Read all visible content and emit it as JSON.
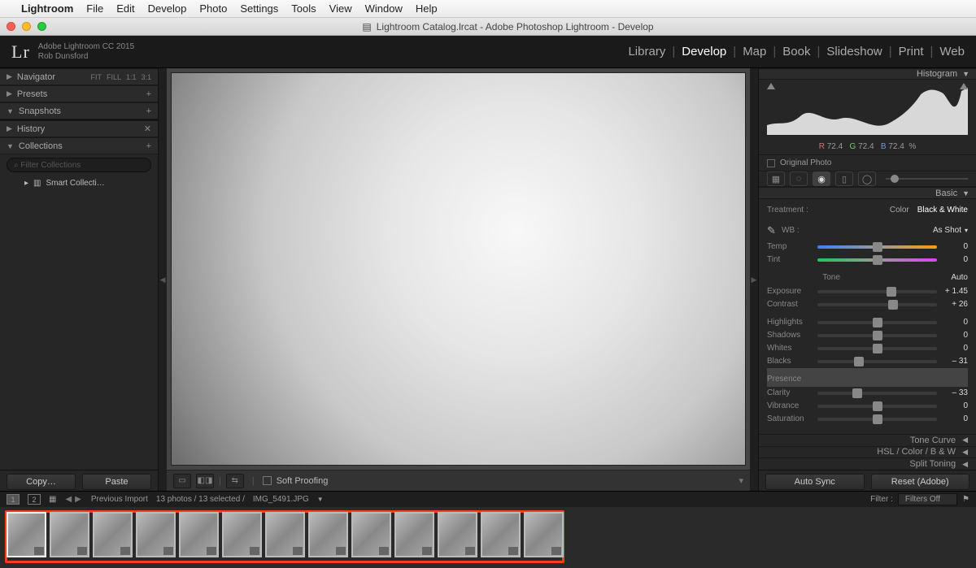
{
  "mac_menu": {
    "apple": "",
    "app": "Lightroom",
    "items": [
      "File",
      "Edit",
      "Develop",
      "Photo",
      "Settings",
      "Tools",
      "View",
      "Window",
      "Help"
    ]
  },
  "window_title": "Lightroom Catalog.lrcat - Adobe Photoshop Lightroom - Develop",
  "identity": {
    "product": "Adobe Lightroom CC 2015",
    "user": "Rob Dunsford",
    "logo": "Lr"
  },
  "modules": {
    "items": [
      "Library",
      "Develop",
      "Map",
      "Book",
      "Slideshow",
      "Print",
      "Web"
    ],
    "active": "Develop"
  },
  "left_panels": {
    "navigator": {
      "label": "Navigator",
      "opts": [
        "FIT",
        "FILL",
        "1:1",
        "3:1"
      ]
    },
    "presets": {
      "label": "Presets"
    },
    "snapshots": {
      "label": "Snapshots"
    },
    "history": {
      "label": "History"
    },
    "collections": {
      "label": "Collections",
      "search_placeholder": "Filter Collections",
      "item": "Smart Collecti…"
    }
  },
  "left_buttons": {
    "copy": "Copy…",
    "paste": "Paste"
  },
  "soft_proof": {
    "label": "Soft Proofing",
    "checked": false
  },
  "histogram": {
    "label": "Histogram",
    "readout": {
      "r": "72.4",
      "g": "72.4",
      "b": "72.4",
      "pct": "%"
    },
    "original_photo": "Original Photo"
  },
  "basic": {
    "label": "Basic",
    "treatment": {
      "label": "Treatment :",
      "color": "Color",
      "bw": "Black & White",
      "active": "bw"
    },
    "wb": {
      "label": "WB :",
      "preset": "As Shot",
      "temp": {
        "label": "Temp",
        "value": "0",
        "pos": 50
      },
      "tint": {
        "label": "Tint",
        "value": "0",
        "pos": 50
      }
    },
    "tone": {
      "label": "Tone",
      "auto": "Auto",
      "exposure": {
        "label": "Exposure",
        "value": "+ 1.45",
        "pos": 62
      },
      "contrast": {
        "label": "Contrast",
        "value": "+ 26",
        "pos": 63
      },
      "highlights": {
        "label": "Highlights",
        "value": "0",
        "pos": 50
      },
      "shadows": {
        "label": "Shadows",
        "value": "0",
        "pos": 50
      },
      "whites": {
        "label": "Whites",
        "value": "0",
        "pos": 50
      },
      "blacks": {
        "label": "Blacks",
        "value": "– 31",
        "pos": 35
      }
    },
    "presence": {
      "label": "Presence",
      "clarity": {
        "label": "Clarity",
        "value": "– 33",
        "pos": 33
      },
      "vibrance": {
        "label": "Vibrance",
        "value": "0",
        "pos": 50
      },
      "saturation": {
        "label": "Saturation",
        "value": "0",
        "pos": 50
      }
    }
  },
  "right_collapsed": {
    "tone_curve": "Tone Curve",
    "hsl": "HSL  /  Color  /  B & W",
    "split": "Split Toning"
  },
  "right_buttons": {
    "sync": "Auto Sync",
    "reset": "Reset (Adobe)"
  },
  "filmstrip_bar": {
    "screens": [
      "1",
      "2"
    ],
    "source": "Previous Import",
    "count": "13 photos / 13 selected /",
    "filename": "IMG_5491.JPG",
    "filter_label": "Filter :",
    "filter_value": "Filters Off"
  },
  "thumbnails": 13
}
